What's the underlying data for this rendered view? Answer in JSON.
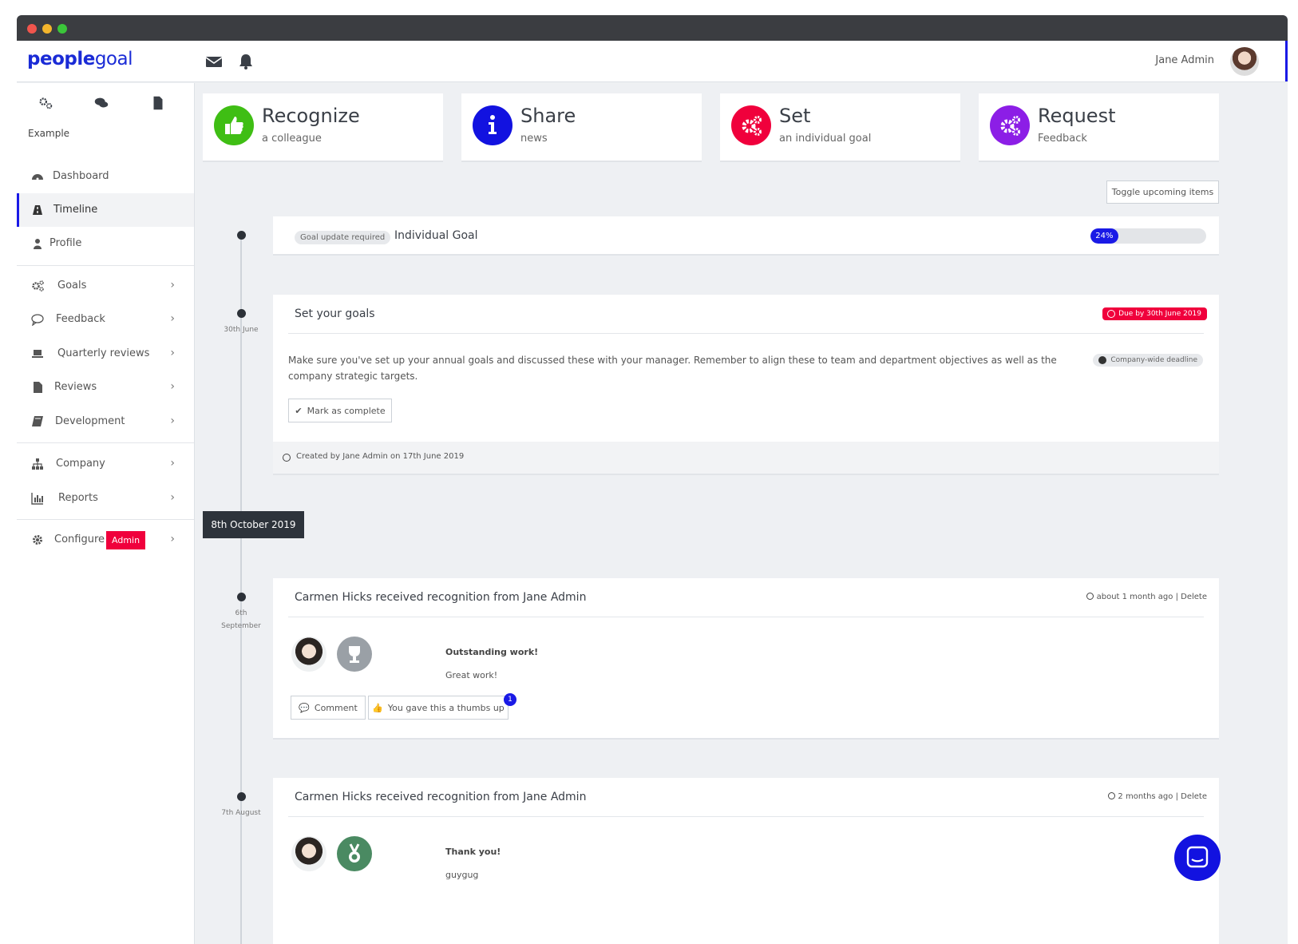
{
  "app": {
    "logo_part1": "people",
    "logo_part2": "goal",
    "user_name": "Jane Admin"
  },
  "colors": {
    "brand": "#1a2bd6",
    "accent_blue": "#1a1ae6",
    "danger": "#f0003c",
    "green": "#3fbe14",
    "purple": "#8c1ee6"
  },
  "topbar": {
    "icons": [
      "envelope-icon",
      "bell-icon"
    ]
  },
  "sidebar": {
    "quick_icons": [
      "goals-quick-icon",
      "chat-quick-icon",
      "document-quick-icon"
    ],
    "section_label": "Example",
    "items": [
      {
        "label": "Dashboard",
        "icon": "dashboard-icon"
      },
      {
        "label": "Timeline",
        "icon": "road-icon",
        "active": true
      },
      {
        "label": "Profile",
        "icon": "user-icon"
      },
      {
        "label": "Goals",
        "icon": "cogs-icon"
      },
      {
        "label": "Feedback",
        "icon": "speech-bubble-icon"
      },
      {
        "label": "Quarterly reviews",
        "icon": "laptop-icon"
      },
      {
        "label": "Reviews",
        "icon": "file-icon"
      },
      {
        "label": "Development",
        "icon": "book-icon"
      },
      {
        "label": "Company",
        "icon": "sitemap-icon"
      },
      {
        "label": "Reports",
        "icon": "bar-chart-icon"
      },
      {
        "label": "Configure",
        "icon": "gear-icon",
        "badge": "Admin"
      }
    ]
  },
  "actions": [
    {
      "title": "Recognize",
      "subtitle": "a colleague",
      "icon": "thumbs-up-icon",
      "color": "#3fbe14"
    },
    {
      "title": "Share",
      "subtitle": "news",
      "icon": "info-icon",
      "color": "#1212e0"
    },
    {
      "title": "Set",
      "subtitle": "an individual goal",
      "icon": "cogs-icon",
      "color": "#f0003c"
    },
    {
      "title": "Request",
      "subtitle": "Feedback",
      "icon": "cogs-icon",
      "color": "#8c1ee6"
    }
  ],
  "toggle_upcoming": "Toggle upcoming items",
  "goal_card": {
    "pill": "Goal update required",
    "title": "Individual Goal",
    "progress_label": "24%",
    "progress": 0.24
  },
  "set_goals_card": {
    "date": "30th June",
    "title": "Set your goals",
    "due_badge": "Due by 30th June 2019",
    "body": "Make sure you've set up your annual goals and discussed these with your manager. Remember to align these to team and department objectives as well as the company strategic targets.",
    "deadline_pill": "Company-wide deadline",
    "mark_complete": "Mark as complete",
    "created_by": "Created by Jane Admin on 17th June 2019"
  },
  "date_separator": "8th October 2019",
  "recognitions": [
    {
      "date_line1": "6th",
      "date_line2": "September",
      "title": "Carmen Hicks received recognition from Jane Admin",
      "time": "about 1 month ago",
      "delete": "Delete",
      "heading": "Outstanding work!",
      "message": "Great work!",
      "comment_label": "Comment",
      "thumbs_label": "You gave this a thumbs up",
      "thumbs_count": "1",
      "badge_icon": "trophy-icon"
    },
    {
      "date_line1": "7th August",
      "title": "Carmen Hicks received recognition from Jane Admin",
      "time": "2 months ago",
      "delete": "Delete",
      "heading": "Thank you!",
      "message": "guygug",
      "badge_icon": "medal-icon"
    }
  ]
}
